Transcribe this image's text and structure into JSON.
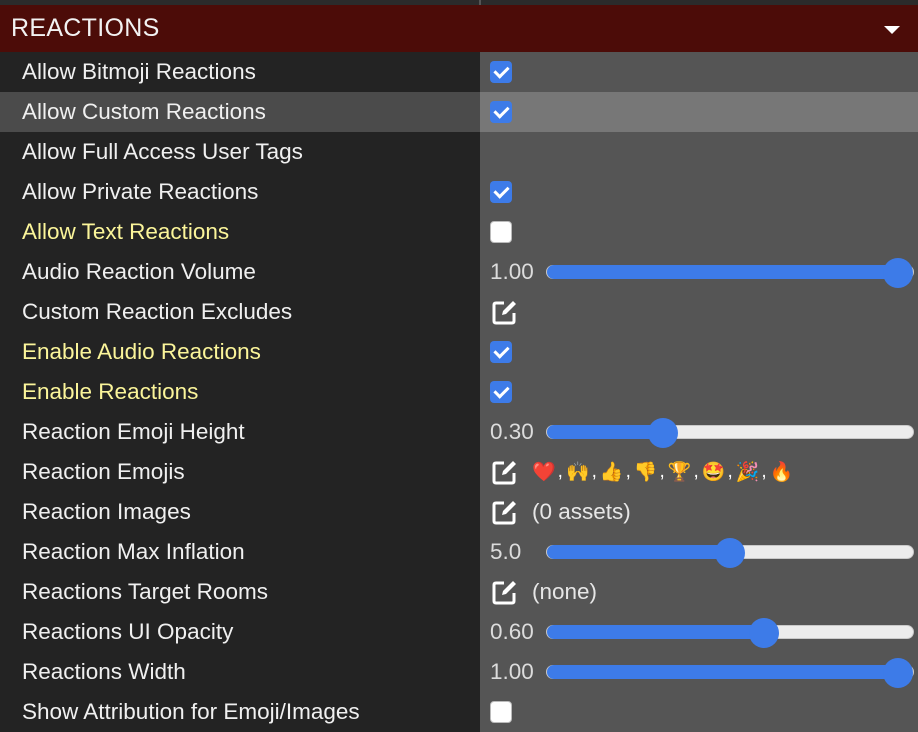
{
  "section": {
    "title": "REACTIONS",
    "collapse_icon": "caret-down-icon"
  },
  "rows": [
    {
      "label": "Allow Bitmoji Reactions",
      "type": "checkbox",
      "checked": true
    },
    {
      "label": "Allow Custom Reactions",
      "type": "checkbox",
      "checked": true,
      "highlighted": true
    },
    {
      "label": "Allow Full Access User Tags",
      "type": "empty"
    },
    {
      "label": "Allow Private Reactions",
      "type": "checkbox",
      "checked": true
    },
    {
      "label": "Allow Text Reactions",
      "type": "checkbox",
      "checked": false,
      "label_color": "yellow"
    },
    {
      "label": "Audio Reaction Volume",
      "type": "slider",
      "value_text": "1.00",
      "fraction": 1.0
    },
    {
      "label": "Custom Reaction Excludes",
      "type": "edit",
      "text": ""
    },
    {
      "label": "Enable Audio Reactions",
      "type": "checkbox",
      "checked": true,
      "label_color": "yellow"
    },
    {
      "label": "Enable Reactions",
      "type": "checkbox",
      "checked": true,
      "label_color": "yellow"
    },
    {
      "label": "Reaction Emoji Height",
      "type": "slider",
      "value_text": "0.30",
      "fraction": 0.3
    },
    {
      "label": "Reaction Emojis",
      "type": "emojis",
      "emojis": [
        "❤️",
        "🙌",
        "👍",
        "👎",
        "🏆",
        "🤩",
        "🎉",
        "🔥"
      ]
    },
    {
      "label": "Reaction Images",
      "type": "edit",
      "text": "(0 assets)"
    },
    {
      "label": "Reaction Max Inflation",
      "type": "slider",
      "value_text": "5.0",
      "fraction": 0.5
    },
    {
      "label": "Reactions Target Rooms",
      "type": "edit",
      "text": "(none)"
    },
    {
      "label": "Reactions UI Opacity",
      "type": "slider",
      "value_text": "0.60",
      "fraction": 0.6
    },
    {
      "label": "Reactions Width",
      "type": "slider",
      "value_text": "1.00",
      "fraction": 1.0
    },
    {
      "label": "Show Attribution for Emoji/Images",
      "type": "checkbox",
      "checked": false
    }
  ],
  "colors": {
    "header_bg": "#4c0c08",
    "accent": "#3d7be8",
    "label_yellow": "#fbf59a"
  }
}
